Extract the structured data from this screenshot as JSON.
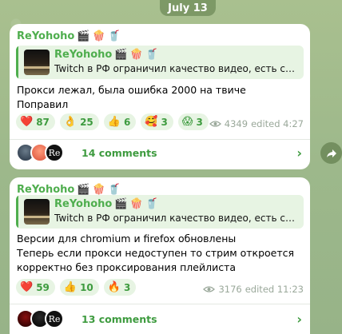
{
  "date_separator": "July 13",
  "colors": {
    "accent": "#4fae4e",
    "quote_bg": "#e7f4e3",
    "background": "#9fb98e"
  },
  "posts": [
    {
      "sender": "ReYohoho",
      "sender_emojis": [
        "🎬",
        "🍿",
        "🥤"
      ],
      "reply": {
        "name": "ReYohoho",
        "name_emojis": [
          "🎬",
          "🍿",
          "🥤"
        ],
        "text": "Twitch в РФ ограничил качество видео, есть сп..."
      },
      "text": "Прокси лежал, была ошибка 2000 на твиче\nПоправил",
      "reactions": [
        {
          "emoji": "❤️",
          "count": "87"
        },
        {
          "emoji": "👌",
          "count": "25"
        },
        {
          "emoji": "👍",
          "count": "6"
        },
        {
          "emoji": "🥰",
          "count": "3"
        },
        {
          "emoji": "😱",
          "count": "3"
        }
      ],
      "views": "4349",
      "edited": "edited 4:27",
      "comments": "14 comments"
    },
    {
      "sender": "ReYohoho",
      "sender_emojis": [
        "🎬",
        "🍿",
        "🥤"
      ],
      "reply": {
        "name": "ReYohoho",
        "name_emojis": [
          "🎬",
          "🍿",
          "🥤"
        ],
        "text": "Twitch в РФ ограничил качество видео, есть спосо..."
      },
      "text": "Версии для chromium и firefox обновлены\nТеперь если прокси недоступен то стрим откроется\nкорректно без проксирования плейлиста",
      "reactions": [
        {
          "emoji": "❤️",
          "count": "59"
        },
        {
          "emoji": "👍",
          "count": "10"
        },
        {
          "emoji": "🔥",
          "count": "3"
        }
      ],
      "views": "3176",
      "edited": "edited 11:23",
      "comments": "13 comments"
    }
  ],
  "icons": {
    "views": "eye-icon",
    "share": "share-arrow-icon",
    "chevron": "chevron-right-icon"
  }
}
